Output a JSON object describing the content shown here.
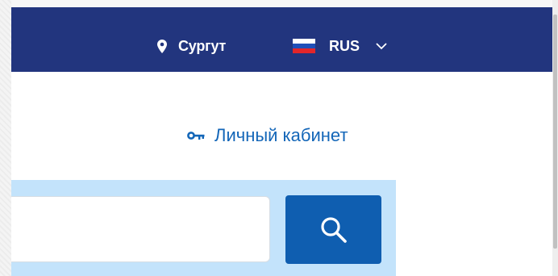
{
  "header": {
    "city": "Сургут",
    "language": "RUS",
    "flag_colors": [
      "#ffffff",
      "#1f4fb8",
      "#e3262a"
    ],
    "background": "#22357e"
  },
  "account": {
    "label": "Личный кабинет",
    "icon": "key-icon",
    "color": "#1366b8"
  },
  "search": {
    "value": "",
    "placeholder": "",
    "button_icon": "search-icon",
    "button_color": "#0f5eb0",
    "band_color": "#c3e3fb"
  },
  "icons": {
    "location": "location-pin-icon",
    "dropdown": "chevron-down-icon"
  }
}
